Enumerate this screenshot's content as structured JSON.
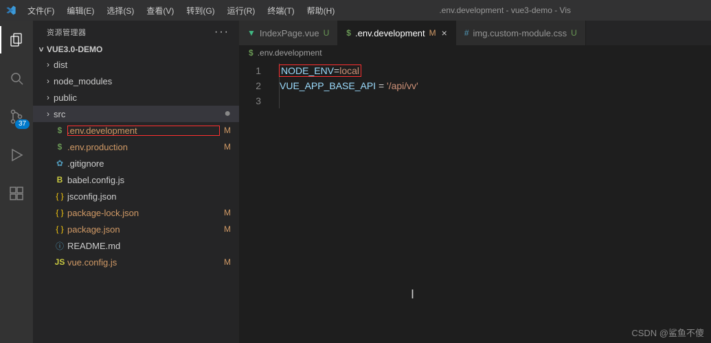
{
  "titlebar": {
    "menus": [
      "文件(F)",
      "编辑(E)",
      "选择(S)",
      "查看(V)",
      "转到(G)",
      "运行(R)",
      "终端(T)",
      "帮助(H)"
    ],
    "title": ".env.development - vue3-demo - Vis"
  },
  "activitybar": {
    "scm_badge": "37"
  },
  "sidebar": {
    "header": "资源管理器",
    "actions": "···",
    "root": "VUE3.0-DEMO",
    "folders": [
      {
        "name": "dist"
      },
      {
        "name": "node_modules"
      },
      {
        "name": "public"
      },
      {
        "name": "src",
        "dirty": true,
        "active": true
      }
    ],
    "files": [
      {
        "name": ".env.development",
        "icon": "env",
        "status": "M",
        "highlight": true
      },
      {
        "name": ".env.production",
        "icon": "env",
        "status": "M"
      },
      {
        "name": ".gitignore",
        "icon": "gear",
        "status": ""
      },
      {
        "name": "babel.config.js",
        "icon": "babel",
        "status": ""
      },
      {
        "name": "jsconfig.json",
        "icon": "json",
        "status": ""
      },
      {
        "name": "package-lock.json",
        "icon": "json",
        "status": "M"
      },
      {
        "name": "package.json",
        "icon": "json",
        "status": "M"
      },
      {
        "name": "README.md",
        "icon": "md",
        "status": ""
      },
      {
        "name": "vue.config.js",
        "icon": "js",
        "status": "M"
      }
    ]
  },
  "tabs": [
    {
      "label": "IndexPage.vue",
      "icon": "vue",
      "status": "U"
    },
    {
      "label": ".env.development",
      "icon": "env",
      "status": "M",
      "active": true,
      "closable": true
    },
    {
      "label": "img.custom-module.css",
      "icon": "css",
      "status": "U"
    }
  ],
  "breadcrumb": {
    "file": ".env.development",
    "icon": "env"
  },
  "editor": {
    "lines": [
      {
        "n": "1",
        "html": [
          {
            "t": "var",
            "v": "NODE_ENV"
          },
          {
            "t": "op",
            "v": "="
          },
          {
            "t": "val",
            "v": "local"
          }
        ],
        "highlight": true
      },
      {
        "n": "2",
        "html": [
          {
            "t": "var",
            "v": "VUE_APP_BASE_API"
          },
          {
            "t": "op",
            "v": " = "
          },
          {
            "t": "str",
            "v": "'/api/vv'"
          }
        ]
      },
      {
        "n": "3",
        "html": []
      }
    ]
  },
  "watermark": "CSDN @鲨鱼不傻"
}
